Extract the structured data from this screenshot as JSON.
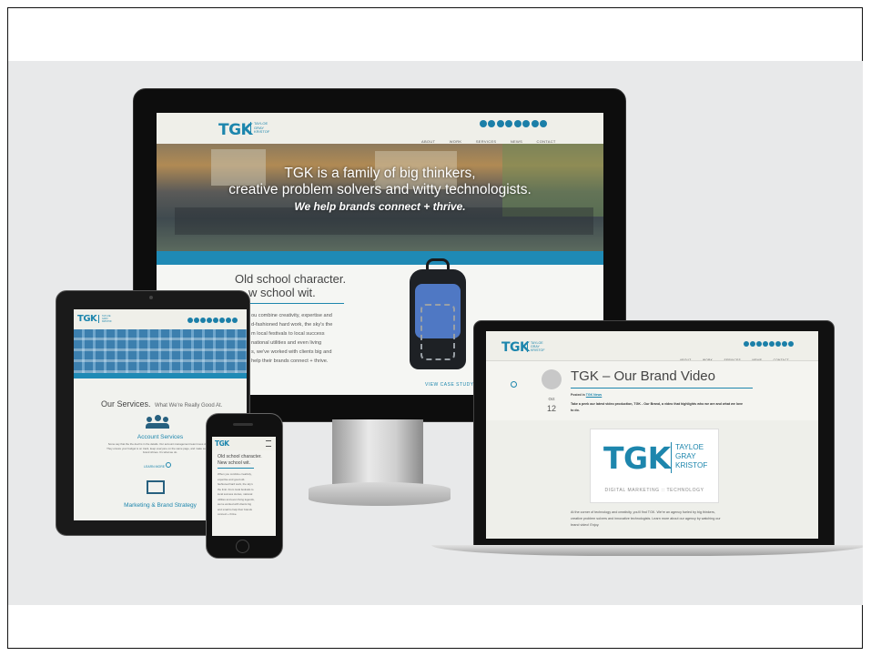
{
  "desktop": {
    "logo": "TGK",
    "logo_lines": [
      "TAYLOE",
      "GRAY",
      "KRISTOF"
    ],
    "nav": [
      "ABOUT",
      "WORK",
      "SERVICES",
      "NEWS",
      "CONTACT"
    ],
    "hero_line1": "TGK is a family of big thinkers,",
    "hero_line2": "creative problem solvers and witty technologists.",
    "hero_tagline": "We help brands connect + thrive.",
    "section_title_line1": "Old school character.",
    "section_title_line2": "w school wit.",
    "body_lines": [
      "ou combine creativity, expertise and",
      "d-fashioned hard work, the sky's the",
      "m local festivals to local success",
      "national utilities and even living",
      "s, we've worked with clients big and",
      "help their brands connect + thrive."
    ],
    "case_study": "VIEW CASE STUDY",
    "colors": {
      "brand": "#1d86ad",
      "hero_band": "#1f8ab5"
    }
  },
  "tablet": {
    "logo": "TGK",
    "logo_lines": [
      "TAYLOE",
      "GRAY",
      "KRISTOF"
    ],
    "services_title": "Our Services.",
    "services_sub": "What We're Really Good At.",
    "account_title": "Account Services",
    "account_body": [
      "Some say that the the devil is in the details. Our account management team loves details!",
      "They ensure your budget is on track, keep everyone on the same page, and make sure your",
      "brand shines. It's what we do."
    ],
    "learn_more": "LEARN MORE",
    "marketing_title": "Marketing & Brand Strategy"
  },
  "phone": {
    "logo": "TGK",
    "title_line1": "Old school character.",
    "title_line2": "New school wit.",
    "body_lines": [
      "When you combine creativity,",
      "expertise and good old-",
      "fashioned hard work, the sky's",
      "the limit. From local festivals to",
      "local success stories, national",
      "utilities and even living legends,",
      "we've worked with clients big",
      "and small to help their brands",
      "connect + thrive."
    ]
  },
  "laptop": {
    "logo": "TGK",
    "logo_lines": [
      "TAYLOE",
      "GRAY",
      "KRISTOF"
    ],
    "nav": [
      "ABOUT",
      "WORK",
      "SERVICES",
      "NEWS",
      "CONTACT"
    ],
    "post_title": "TGK – Our Brand Video",
    "posted_in": "Posted in",
    "posted_link": "TGK News",
    "date_month": "Oct",
    "date_day": "12",
    "intro": "Take a peek our latest video production, TGK - Our Brand, a video that highlights who we are and what we love to do.",
    "card_logo": "TGK",
    "card_name": [
      "TAYLOE",
      "GRAY",
      "KRISTOF"
    ],
    "card_tagline": "DIGITAL MARKETING :: TECHNOLOGY",
    "body": [
      "At the corner of technology and creativity, you'll find TGK. We're an agency fueled by big thinkers,",
      "creative problem solvers and innovative technologists. Learn more about our agency by watching our",
      "brand video! Enjoy."
    ]
  }
}
